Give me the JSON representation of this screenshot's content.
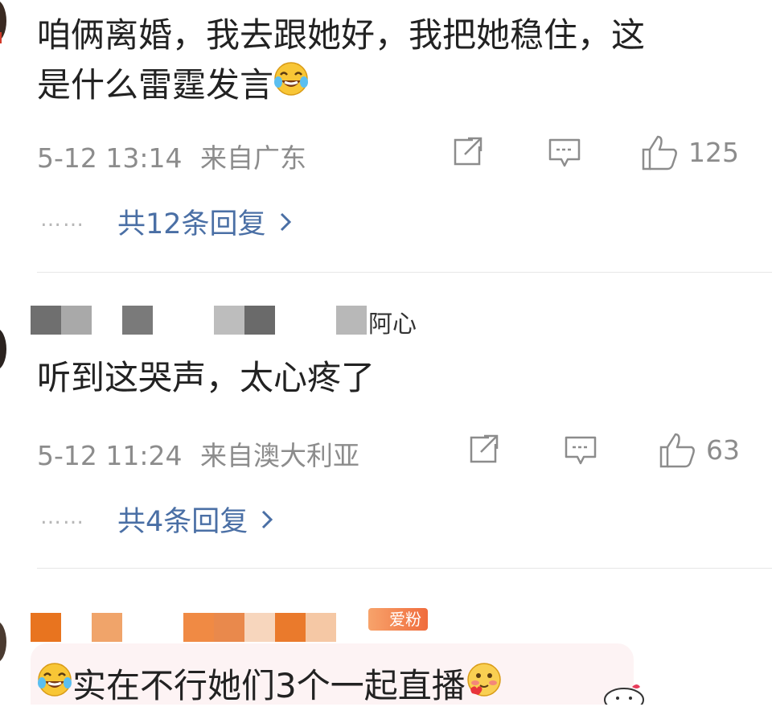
{
  "comments": [
    {
      "text": "咱俩离婚，我去跟她好，我把她稳住，这",
      "text_line2": "是什么雷霆发言",
      "time": "5-12 13:14",
      "location": "来自广东",
      "likes": "125",
      "replies_label": "共12条回复",
      "dots": "……"
    },
    {
      "username_suffix": "阿心",
      "text": "听到这哭声，太心疼了",
      "time": "5-12 11:24",
      "location": "来自澳大利亚",
      "likes": "63",
      "replies_label": "共4条回复",
      "dots": "……"
    },
    {
      "fan_badge": "爱粉",
      "text": "实在不行她们3个一起直播"
    }
  ],
  "colors": {
    "link": "#4a6fa5",
    "meta": "#8c8c8c",
    "fan_badge": "#f06c3d",
    "bubble": "#fdf3f4"
  },
  "icons": [
    "laughing-tears-emoji",
    "share-icon",
    "comment-icon",
    "like-icon",
    "chevron-right-icon",
    "blushing-emoji"
  ]
}
